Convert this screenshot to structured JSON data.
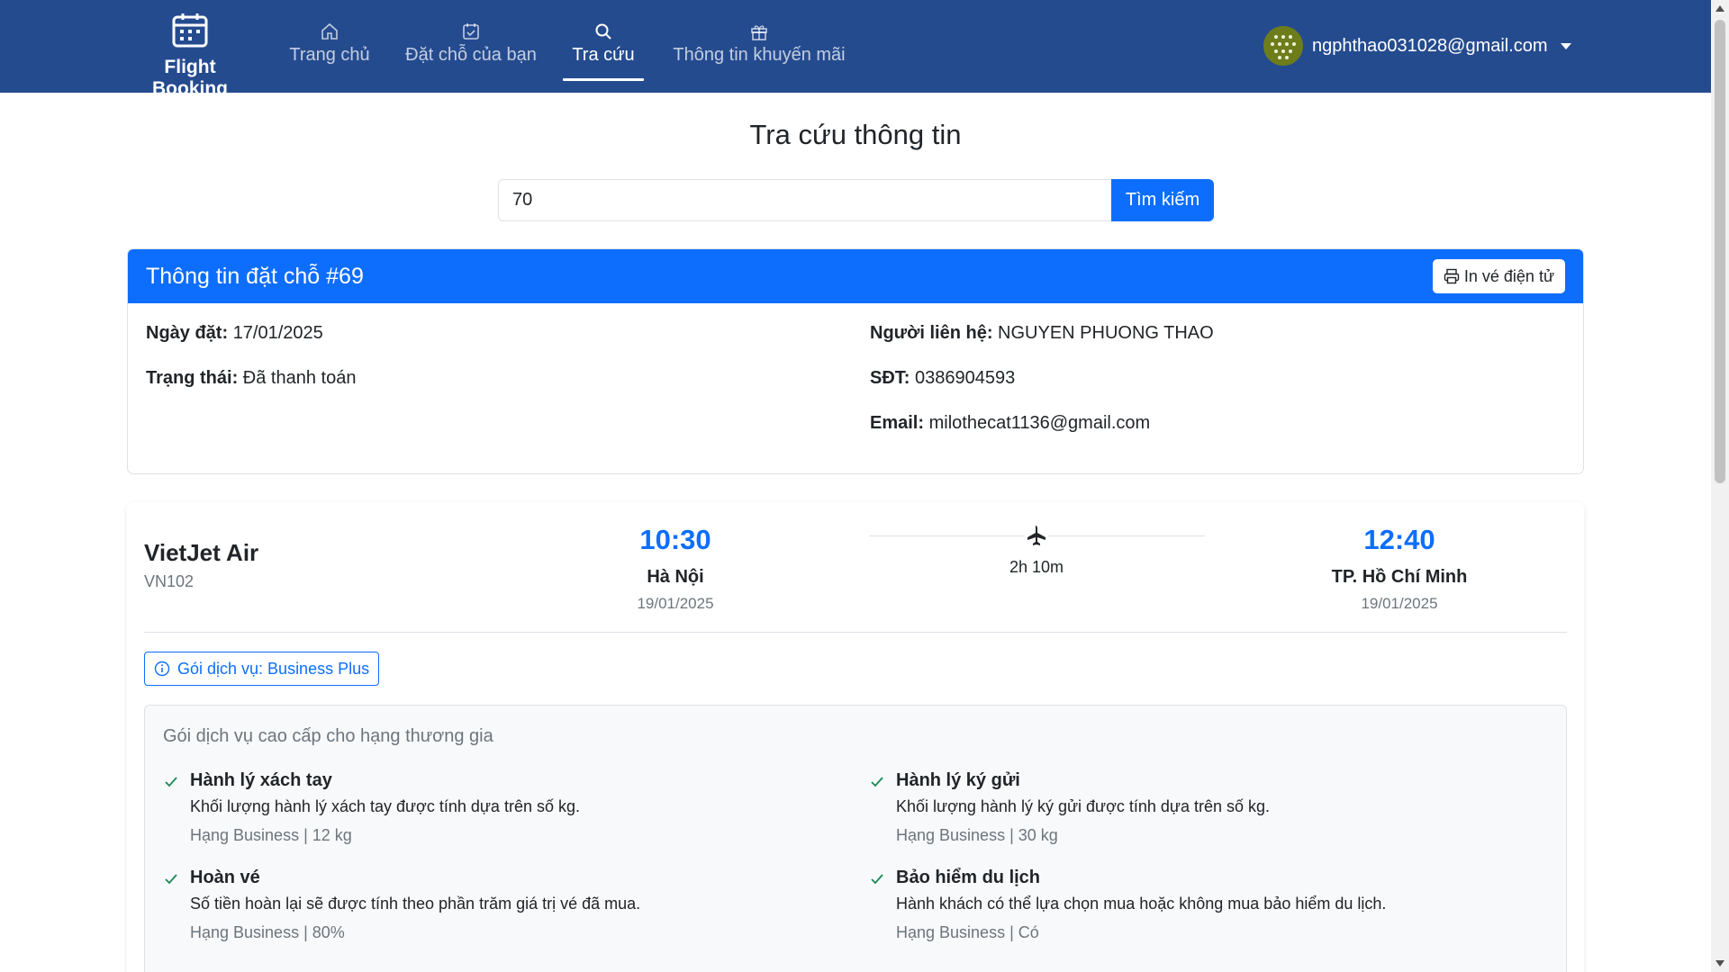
{
  "navbar": {
    "brand": "Flight Booking",
    "items": [
      {
        "label": "Trang chủ",
        "icon": "home-icon"
      },
      {
        "label": "Đặt chỗ của bạn",
        "icon": "calendar-check-icon"
      },
      {
        "label": "Tra cứu",
        "icon": "search-icon",
        "active": true
      },
      {
        "label": "Thông tin khuyến mãi",
        "icon": "gift-icon"
      }
    ],
    "user_email": "ngphthao031028@gmail.com"
  },
  "page": {
    "title": "Tra cứu thông tin"
  },
  "search": {
    "value": "70",
    "button_label": "Tìm kiếm"
  },
  "booking": {
    "title": "Thông tin đặt chỗ #69",
    "print_label": "In vé điện tử",
    "fields": {
      "date_label": "Ngày đặt:",
      "date_value": "17/01/2025",
      "status_label": "Trạng thái:",
      "status_value": "Đã thanh toán",
      "contact_label": "Người liên hệ:",
      "contact_value": "NGUYEN PHUONG THAO",
      "phone_label": "SĐT:",
      "phone_value": "0386904593",
      "email_label": "Email:",
      "email_value": "milothecat1136@gmail.com"
    }
  },
  "flight": {
    "airline": "VietJet Air",
    "flight_no": "VN102",
    "departure": {
      "time": "10:30",
      "city": "Hà Nội",
      "date": "19/01/2025"
    },
    "arrival": {
      "time": "12:40",
      "city": "TP. Hồ Chí Minh",
      "date": "19/01/2025"
    },
    "duration": "2h 10m",
    "package_label": "Gói dịch vụ: Business Plus",
    "package_desc": "Gói dịch vụ cao cấp cho hạng thương gia",
    "features": [
      {
        "title": "Hành lý xách tay",
        "desc": "Khối lượng hành lý xách tay được tính dựa trên số kg.",
        "meta": "Hạng Business | 12 kg"
      },
      {
        "title": "Hành lý ký gửi",
        "desc": "Khối lượng hành lý ký gửi được tính dựa trên số kg.",
        "meta": "Hạng Business | 30 kg"
      },
      {
        "title": "Hoàn vé",
        "desc": "Số tiền hoàn lại sẽ được tính theo phần trăm giá trị vé đã mua.",
        "meta": "Hạng Business | 80%"
      },
      {
        "title": "Bảo hiểm du lịch",
        "desc": "Hành khách có thể lựa chọn mua hoặc không mua bảo hiểm du lịch.",
        "meta": "Hạng Business | Có"
      }
    ]
  },
  "colors": {
    "navbar": "#254b8f",
    "primary": "#0d6efd",
    "check": "#198754"
  }
}
